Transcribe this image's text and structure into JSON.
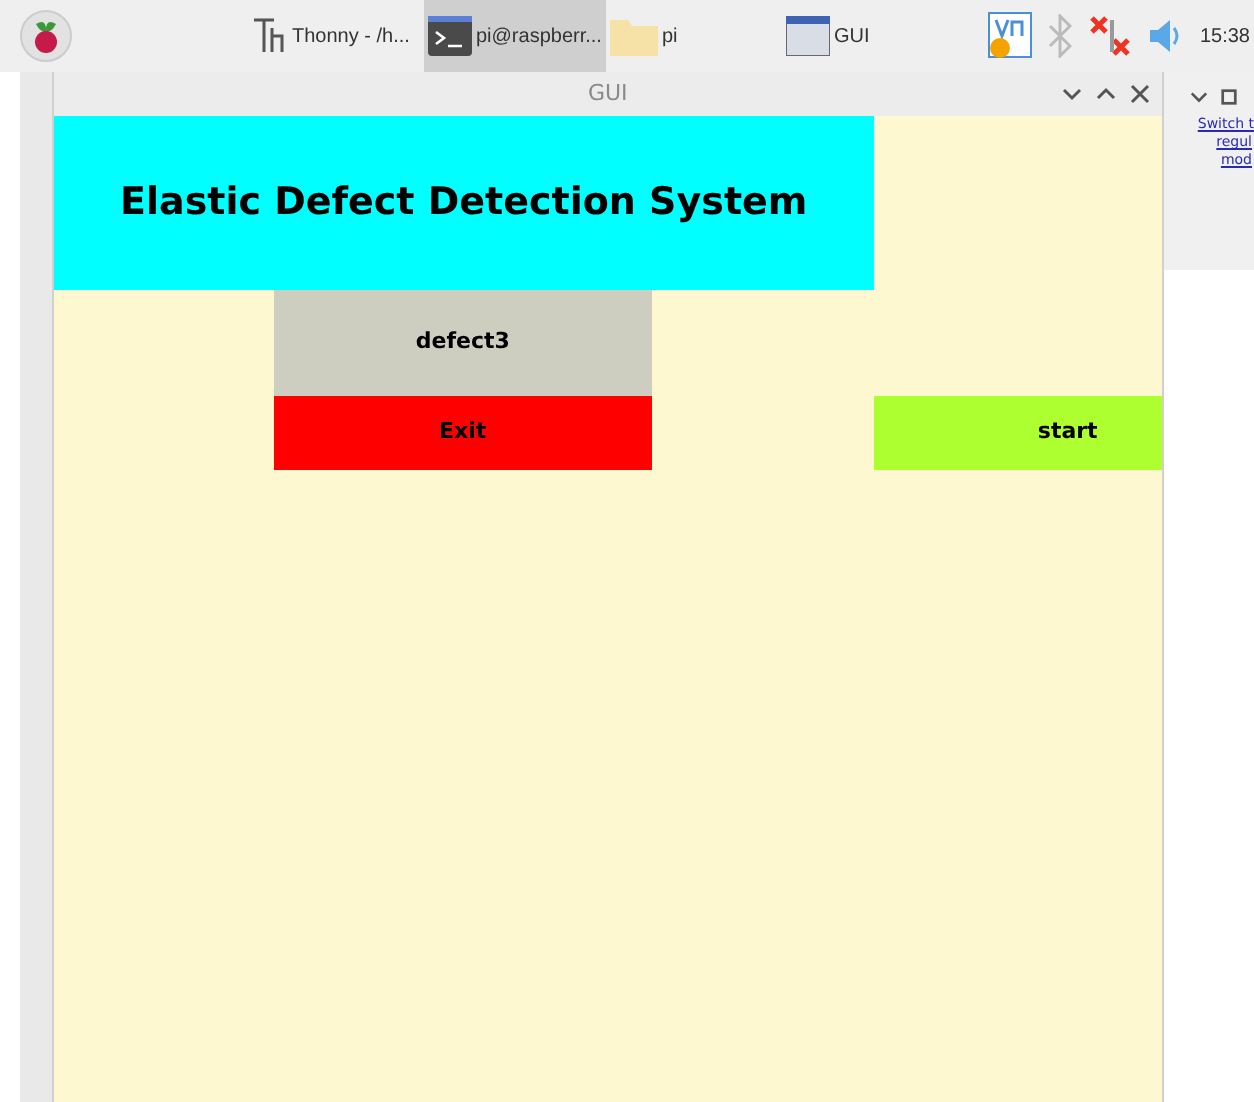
{
  "taskbar": {
    "tasks": [
      {
        "kind": "thonny",
        "label": "Thonny - /h...",
        "selected": false
      },
      {
        "kind": "terminal",
        "label": "pi@raspberr...",
        "selected": true
      },
      {
        "kind": "folder",
        "label": "pi",
        "selected": false
      },
      {
        "kind": "window",
        "label": "GUI",
        "selected": false
      }
    ],
    "clock": "15:38"
  },
  "window": {
    "title": "GUI"
  },
  "app": {
    "header": "Elastic Defect Detection System",
    "result": "defect3",
    "buttons": [
      {
        "label": "Exit",
        "color": "#ff0000"
      },
      {
        "label": "start",
        "color": "#adff2f"
      }
    ]
  },
  "background_window": {
    "link_lines": [
      "Switch t",
      "regul",
      "mod"
    ]
  }
}
